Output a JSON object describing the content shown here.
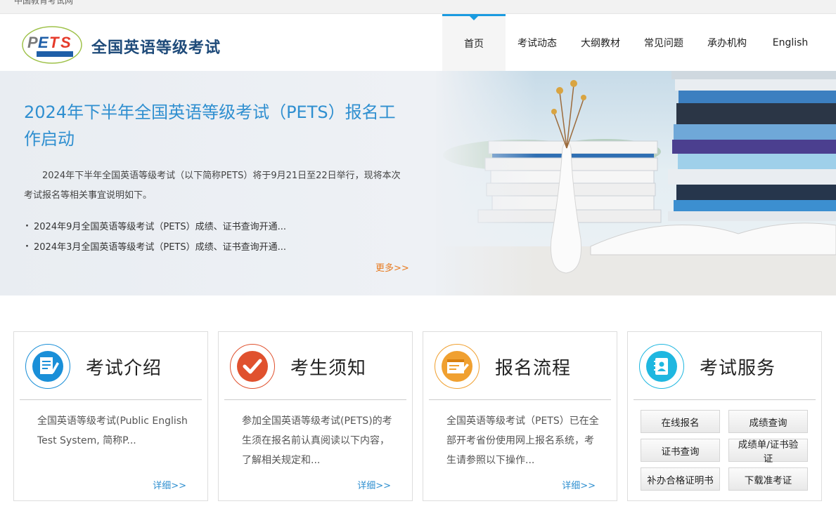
{
  "topbar": {
    "site": "中国教育考试网"
  },
  "header": {
    "logo_text": "PETS",
    "logo_sub": "全国英语等级考试",
    "brand": "全国英语等级考试"
  },
  "nav": [
    {
      "label": "首页",
      "active": true
    },
    {
      "label": "考试动态"
    },
    {
      "label": "大纲教材"
    },
    {
      "label": "常见问题"
    },
    {
      "label": "承办机构"
    },
    {
      "label": "English"
    }
  ],
  "banner": {
    "title": "2024年下半年全国英语等级考试（PETS）报名工作启动",
    "desc": "2024年下半年全国英语等级考试（以下简称PETS）将于9月21日至22日举行，现将本次考试报名等相关事宜说明如下。",
    "news": [
      "2024年9月全国英语等级考试（PETS）成绩、证书查询开通...",
      "2024年3月全国英语等级考试（PETS）成绩、证书查询开通..."
    ],
    "more": "更多>>"
  },
  "cards": [
    {
      "title": "考试介绍",
      "desc": "全国英语等级考试(Public English Test System, 简称P...",
      "more": "详细>>",
      "icon": "document-pen-icon",
      "color": "#1a8fd8"
    },
    {
      "title": "考生须知",
      "desc": "参加全国英语等级考试(PETS)的考生须在报名前认真阅读以下内容，了解相关规定和...",
      "more": "详细>>",
      "icon": "checkmark-icon",
      "color": "#e0512e"
    },
    {
      "title": "报名流程",
      "desc": "全国英语等级考试（PETS）已在全部开考省份使用网上报名系统，考生请参照以下操作...",
      "more": "详细>>",
      "icon": "form-pen-icon",
      "color": "#f0a030"
    },
    {
      "title": "考试服务",
      "icon": "contacts-book-icon",
      "color": "#1fb7e0",
      "services": [
        "在线报名",
        "成绩查询",
        "证书查询",
        "成绩单/证书验证",
        "补办合格证明书",
        "下载准考证"
      ]
    }
  ]
}
